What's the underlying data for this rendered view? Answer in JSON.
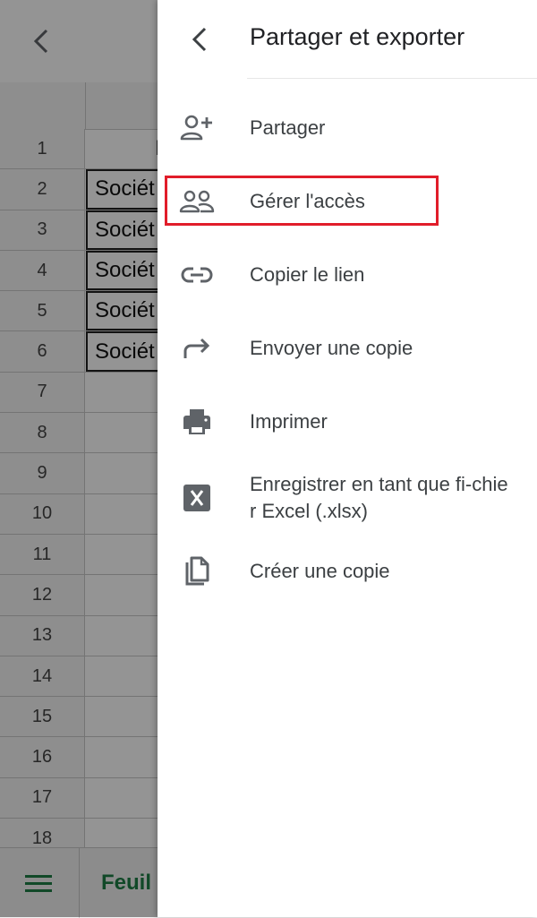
{
  "sheet": {
    "row_numbers": [
      "1",
      "2",
      "3",
      "4",
      "5",
      "6",
      "7",
      "8",
      "9",
      "10",
      "11",
      "12",
      "13",
      "14",
      "15",
      "16",
      "17",
      "18"
    ],
    "cells": [
      "I",
      "Sociét",
      "Sociét",
      "Sociét",
      "Sociét",
      "Sociét",
      "",
      "",
      "",
      "",
      "",
      "",
      "",
      "",
      "",
      "",
      "",
      ""
    ],
    "sheet_tab": "Feuil"
  },
  "drawer": {
    "title": "Partager et exporter",
    "items": [
      {
        "label": "Partager",
        "icon": "person-add-icon"
      },
      {
        "label": "Gérer l'accès",
        "icon": "people-icon"
      },
      {
        "label": "Copier le lien",
        "icon": "link-icon"
      },
      {
        "label": "Envoyer une copie",
        "icon": "forward-arrow-icon"
      },
      {
        "label": "Imprimer",
        "icon": "printer-icon"
      },
      {
        "label": "Enregistrer en tant que fi-chier Excel (.xlsx)",
        "icon": "excel-icon"
      },
      {
        "label": "Créer une copie",
        "icon": "copy-icon"
      }
    ]
  },
  "colors": {
    "accent_green": "#1e7e45",
    "highlight_red": "#e11d2a",
    "icon_gray": "#5f6368"
  }
}
